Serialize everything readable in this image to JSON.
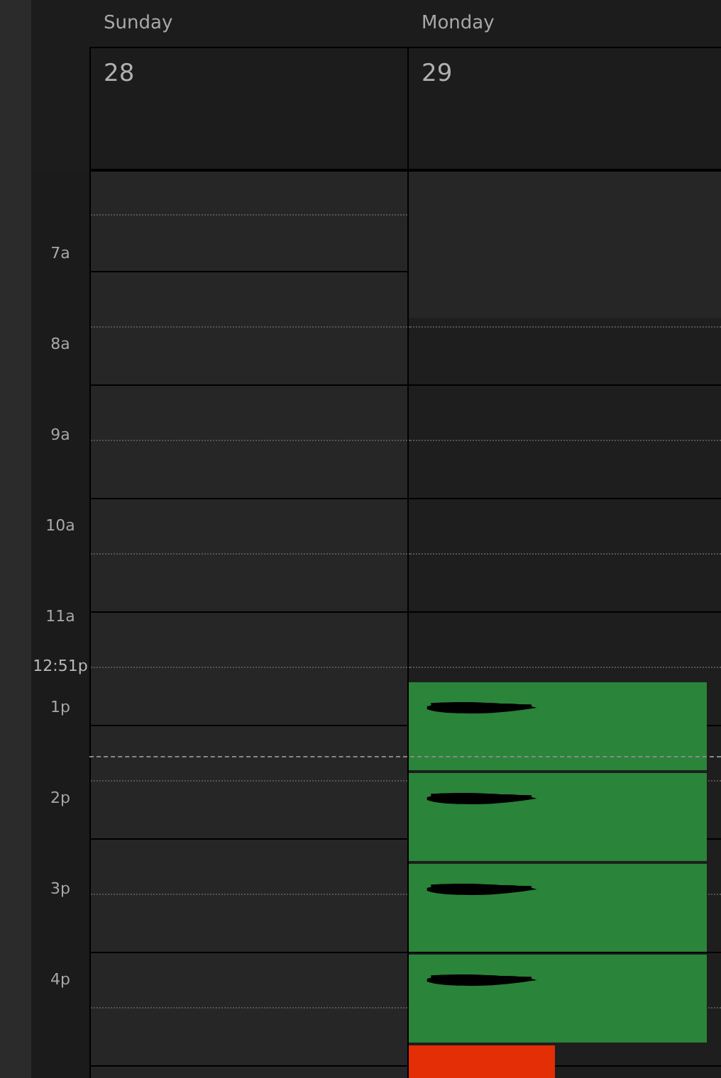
{
  "days": [
    {
      "name": "Sunday",
      "date": "28"
    },
    {
      "name": "Monday",
      "date": "29",
      "events": [
        {
          "color": "#2a8439",
          "redacted": true
        },
        {
          "color": "#2a8439",
          "redacted": true
        },
        {
          "color": "#2a8439",
          "redacted": true
        },
        {
          "color": "#2a8439",
          "redacted": true
        },
        {
          "color": "#e32e06",
          "redacted": false
        }
      ]
    }
  ],
  "time_labels": [
    {
      "text": "7a",
      "kind": "hour"
    },
    {
      "text": "8a",
      "kind": "hour"
    },
    {
      "text": "9a",
      "kind": "hour"
    },
    {
      "text": "10a",
      "kind": "hour"
    },
    {
      "text": "11a",
      "kind": "hour"
    },
    {
      "text": "12:51p",
      "kind": "now"
    },
    {
      "text": "1p",
      "kind": "hour"
    },
    {
      "text": "2p",
      "kind": "hour"
    },
    {
      "text": "3p",
      "kind": "hour"
    },
    {
      "text": "4p",
      "kind": "hour"
    }
  ]
}
